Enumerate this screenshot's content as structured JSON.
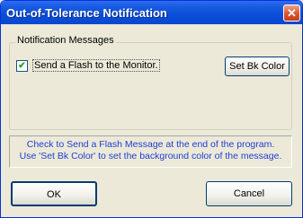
{
  "window": {
    "title": "Out-of-Tolerance Notification"
  },
  "titlebar": {
    "close_glyph": "✕",
    "close_icon": "close-icon"
  },
  "group": {
    "label": "Notification Messages",
    "checkbox": {
      "label": "Send a Flash to the Monitor.",
      "checked": true,
      "check_glyph": "✔"
    },
    "set_bk_color_label": "Set Bk Color"
  },
  "help": {
    "line1": "Check to Send a Flash Message at the end of the program.",
    "line2": "Use 'Set Bk Color' to set the background color of the message.",
    "color": "#1e3fd4"
  },
  "buttons": {
    "ok_label": "OK",
    "cancel_label": "Cancel"
  },
  "colors": {
    "titlebar": "#0a4fd8",
    "close_button": "#d9542c",
    "dialog_bg": "#ece9d8"
  }
}
